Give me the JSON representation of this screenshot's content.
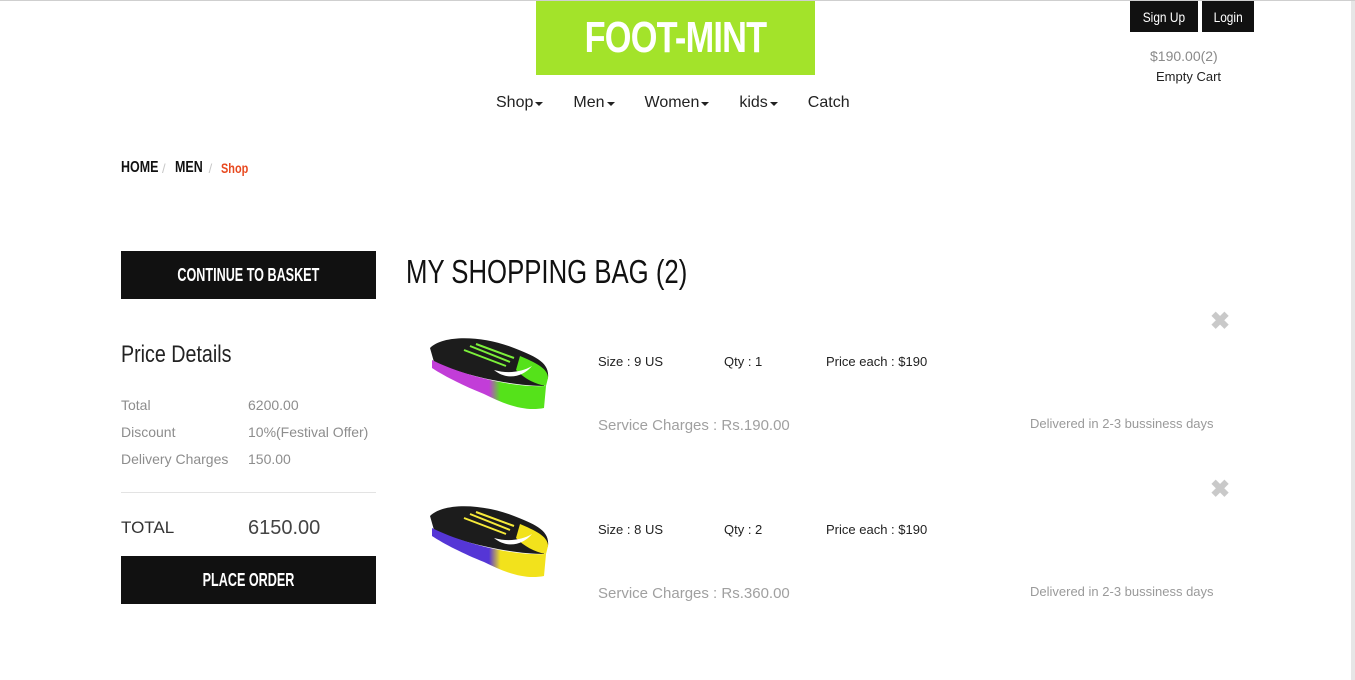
{
  "header": {
    "logo": "FOOT-MINT",
    "signup_label": "Sign Up",
    "login_label": "Login",
    "cart_total": "$190.00(2)",
    "empty_cart_label": "Empty Cart"
  },
  "nav": {
    "items": [
      {
        "label": "Shop",
        "has_dropdown": true
      },
      {
        "label": "Men",
        "has_dropdown": true
      },
      {
        "label": "Women",
        "has_dropdown": true
      },
      {
        "label": "kids",
        "has_dropdown": true
      },
      {
        "label": "Catch",
        "has_dropdown": false
      }
    ]
  },
  "breadcrumb": {
    "items": [
      "HOME",
      "MEN",
      "Shop"
    ],
    "separator": "/"
  },
  "sidebar": {
    "continue_label": "CONTINUE TO BASKET",
    "price_details_title": "Price Details",
    "rows": [
      {
        "label": "Total",
        "value": "6200.00"
      },
      {
        "label": "Discount",
        "value": "10%(Festival Offer)"
      },
      {
        "label": "Delivery Charges",
        "value": "150.00"
      }
    ],
    "total_label": "TOTAL",
    "total_value": "6150.00",
    "place_order_label": "PLACE ORDER"
  },
  "bag": {
    "title": "MY SHOPPING BAG (2)",
    "items": [
      {
        "image": "shoe-green-purple",
        "size": "Size : 9 US",
        "qty": "Qty : 1",
        "price": "Price each : $190",
        "service": "Service Charges : Rs.190.00",
        "delivery": "Delivered in 2-3 bussiness days"
      },
      {
        "image": "shoe-yellow-purple",
        "size": "Size : 8 US",
        "qty": "Qty : 2",
        "price": "Price each : $190",
        "service": "Service Charges : Rs.360.00",
        "delivery": "Delivered in 2-3 bussiness days"
      }
    ]
  },
  "colors": {
    "brand": "#a3e32a",
    "dark": "#111111",
    "breadcrumb_active": "#e8491f",
    "muted": "#8d8d8d"
  }
}
